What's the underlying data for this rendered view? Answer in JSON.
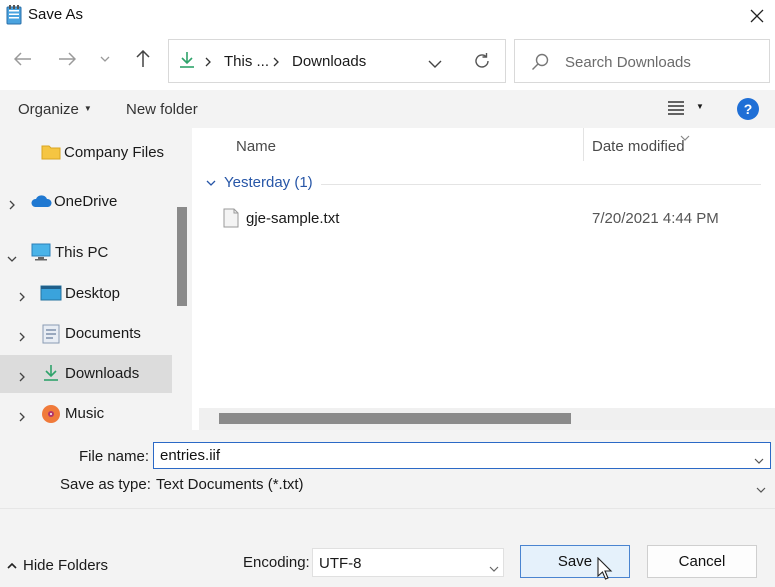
{
  "window": {
    "title": "Save As",
    "icon": "notepad-icon"
  },
  "nav": {
    "back": "back-arrow-icon",
    "forward": "forward-arrow-icon",
    "recent": "chevron-down-icon",
    "up": "up-arrow-icon",
    "address": {
      "segments": [
        "This ...",
        "Downloads"
      ],
      "icon": "download-icon"
    },
    "search_placeholder": "Search Downloads"
  },
  "command_bar": {
    "organize": "Organize",
    "new_folder": "New folder",
    "help": "?"
  },
  "sidebar": {
    "items": [
      {
        "label": "Company Files",
        "icon": "folder-icon"
      },
      {
        "label": "OneDrive",
        "icon": "cloud-icon"
      },
      {
        "label": "This PC",
        "icon": "monitor-icon"
      },
      {
        "label": "Desktop",
        "icon": "desktop-icon"
      },
      {
        "label": "Documents",
        "icon": "documents-icon"
      },
      {
        "label": "Downloads",
        "icon": "download-icon",
        "selected": true
      },
      {
        "label": "Music",
        "icon": "music-icon"
      }
    ]
  },
  "file_list": {
    "columns": [
      "Name",
      "Date modified"
    ],
    "groups": [
      {
        "label": "Yesterday (1)",
        "files": [
          {
            "name": "gje-sample.txt",
            "date": "7/20/2021 4:44 PM",
            "icon": "text-file-icon"
          }
        ]
      }
    ]
  },
  "form": {
    "file_name_label": "File name:",
    "file_name_value": "entries.iif",
    "save_type_label": "Save as type:",
    "save_type_value": "Text Documents (*.txt)"
  },
  "footer": {
    "hide_folders": "Hide Folders",
    "encoding_label": "Encoding:",
    "encoding_value": "UTF-8",
    "save": "Save",
    "cancel": "Cancel"
  },
  "colors": {
    "accent": "#1f6fd6",
    "selection": "#dcdcdc",
    "group_header": "#2756a7"
  }
}
